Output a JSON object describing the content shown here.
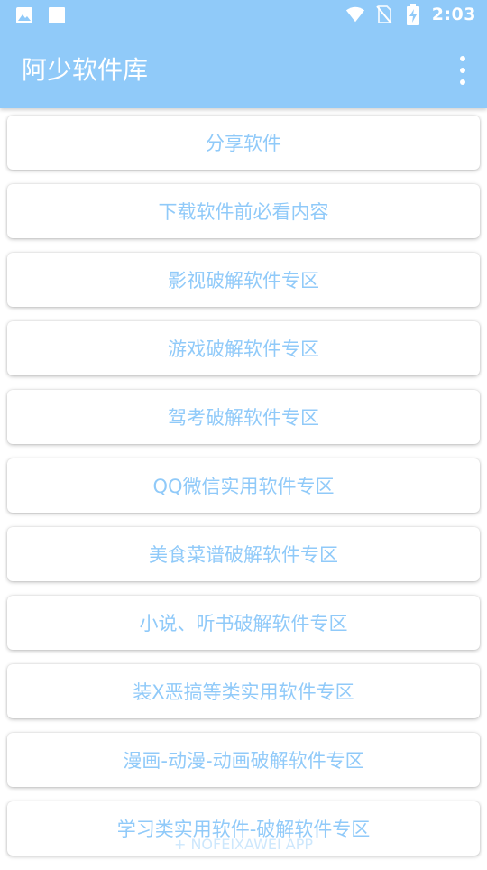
{
  "status_bar": {
    "time": "2:03",
    "left_icons": [
      "image-icon",
      "square-icon"
    ],
    "right_icons": [
      "wifi-icon",
      "no-sim-icon",
      "battery-charging-icon"
    ]
  },
  "toolbar": {
    "title": "阿少软件库",
    "overflow_icon": "more-vert-icon"
  },
  "menu_items": [
    {
      "label": "分享软件"
    },
    {
      "label": "下载软件前必看内容"
    },
    {
      "label": "影视破解软件专区"
    },
    {
      "label": "游戏破解软件专区"
    },
    {
      "label": "驾考破解软件专区"
    },
    {
      "label": "QQ微信实用软件专区"
    },
    {
      "label": "美食菜谱破解软件专区"
    },
    {
      "label": "小说、听书破解软件专区"
    },
    {
      "label": "装X恶搞等类实用软件专区"
    },
    {
      "label": "漫画-动漫-动画破解软件专区"
    },
    {
      "label": "学习类实用软件-破解软件专区"
    }
  ],
  "watermark": "+ NOFEIXAWEI APP",
  "colors": {
    "accent": "#90caf9",
    "card_text": "#90caf9",
    "background": "#ffffff"
  }
}
